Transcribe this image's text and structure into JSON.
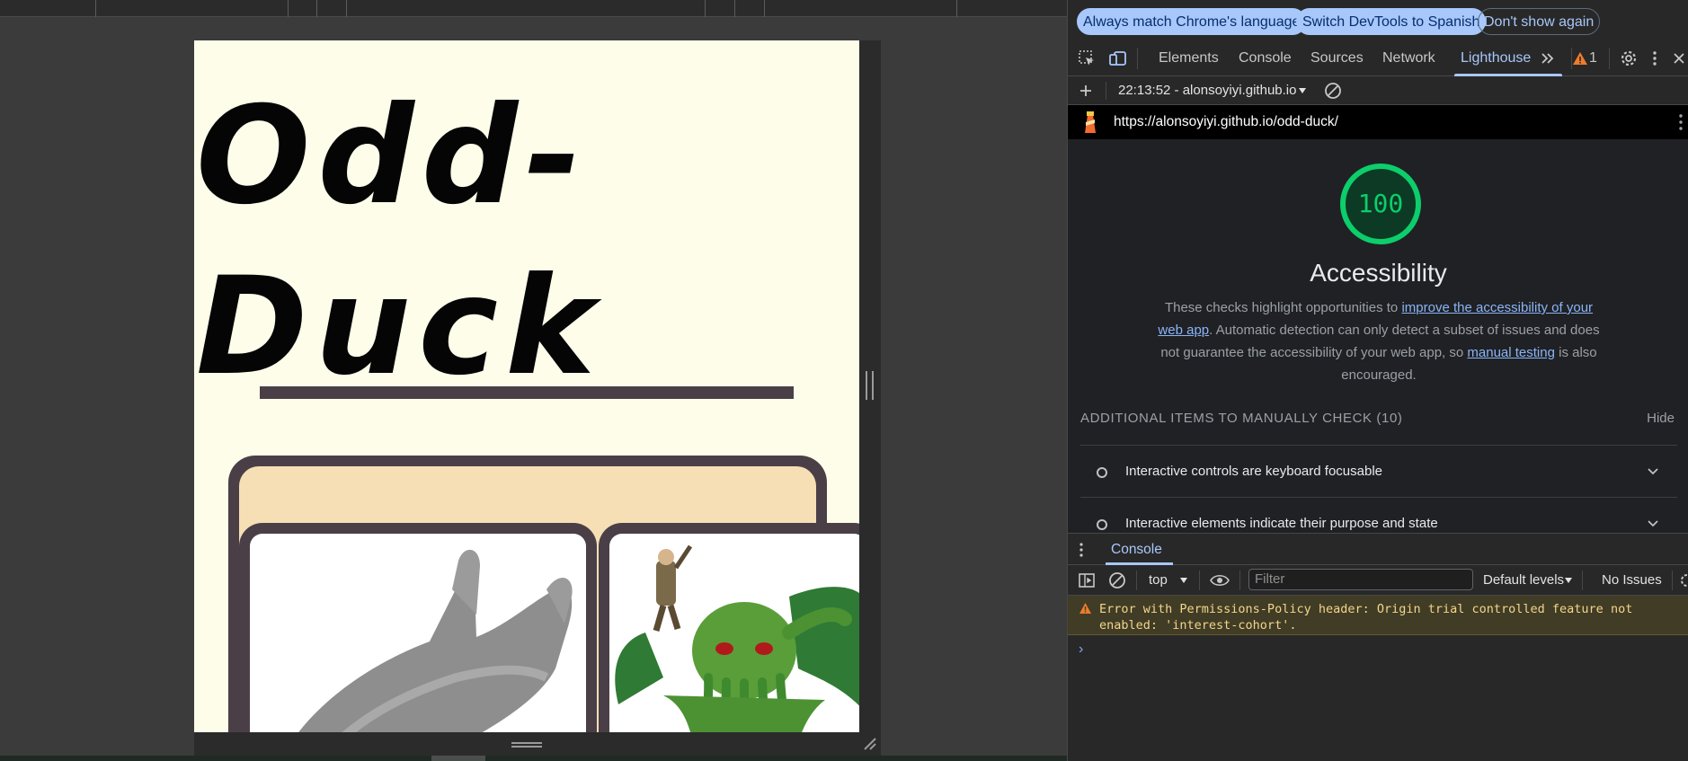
{
  "page": {
    "title_line1": "Odd-",
    "title_line2": "Duck"
  },
  "devtools": {
    "infobar": {
      "always_match": "Always match Chrome's language",
      "switch_spanish": "Switch DevTools to Spanish",
      "dont_show": "Don't show again"
    },
    "tabs": [
      {
        "label": "Elements"
      },
      {
        "label": "Console"
      },
      {
        "label": "Sources"
      },
      {
        "label": "Network"
      },
      {
        "label": "Lighthouse"
      }
    ],
    "active_tab": "Lighthouse",
    "issue_count": "1",
    "lighthouse": {
      "report_selector": "22:13:52 - alonsoyiyi.github.io",
      "url": "https://alonsoyiyi.github.io/odd-duck/",
      "score": "100",
      "category": "Accessibility",
      "desc_part1": "These checks highlight opportunities to ",
      "desc_link1": "improve the accessibility of your web app",
      "desc_part2": ". Automatic detection can only detect a subset of issues and does not guarantee the accessibility of your web app, so ",
      "desc_link2": "manual testing",
      "desc_part3": " is also encouraged.",
      "manual_header": "ADDITIONAL ITEMS TO MANUALLY CHECK (10)",
      "hide_label": "Hide",
      "audits": [
        {
          "label": "Interactive controls are keyboard focusable"
        },
        {
          "label": "Interactive elements indicate their purpose and state"
        }
      ]
    },
    "drawer": {
      "tab_label": "Console",
      "context": "top",
      "filter_placeholder": "Filter",
      "levels": "Default levels",
      "issues": "No Issues",
      "warning_text": "Error with Permissions-Policy header: Origin trial controlled feature not enabled: 'interest-cohort'.",
      "prompt": "›"
    }
  },
  "colors": {
    "page_bg": "#fdfdea",
    "card_frame": "#4a3f47",
    "card_inner": "#f6dfb5",
    "score_green": "#0cce6b",
    "devtools_accent": "#a8c7fa"
  }
}
